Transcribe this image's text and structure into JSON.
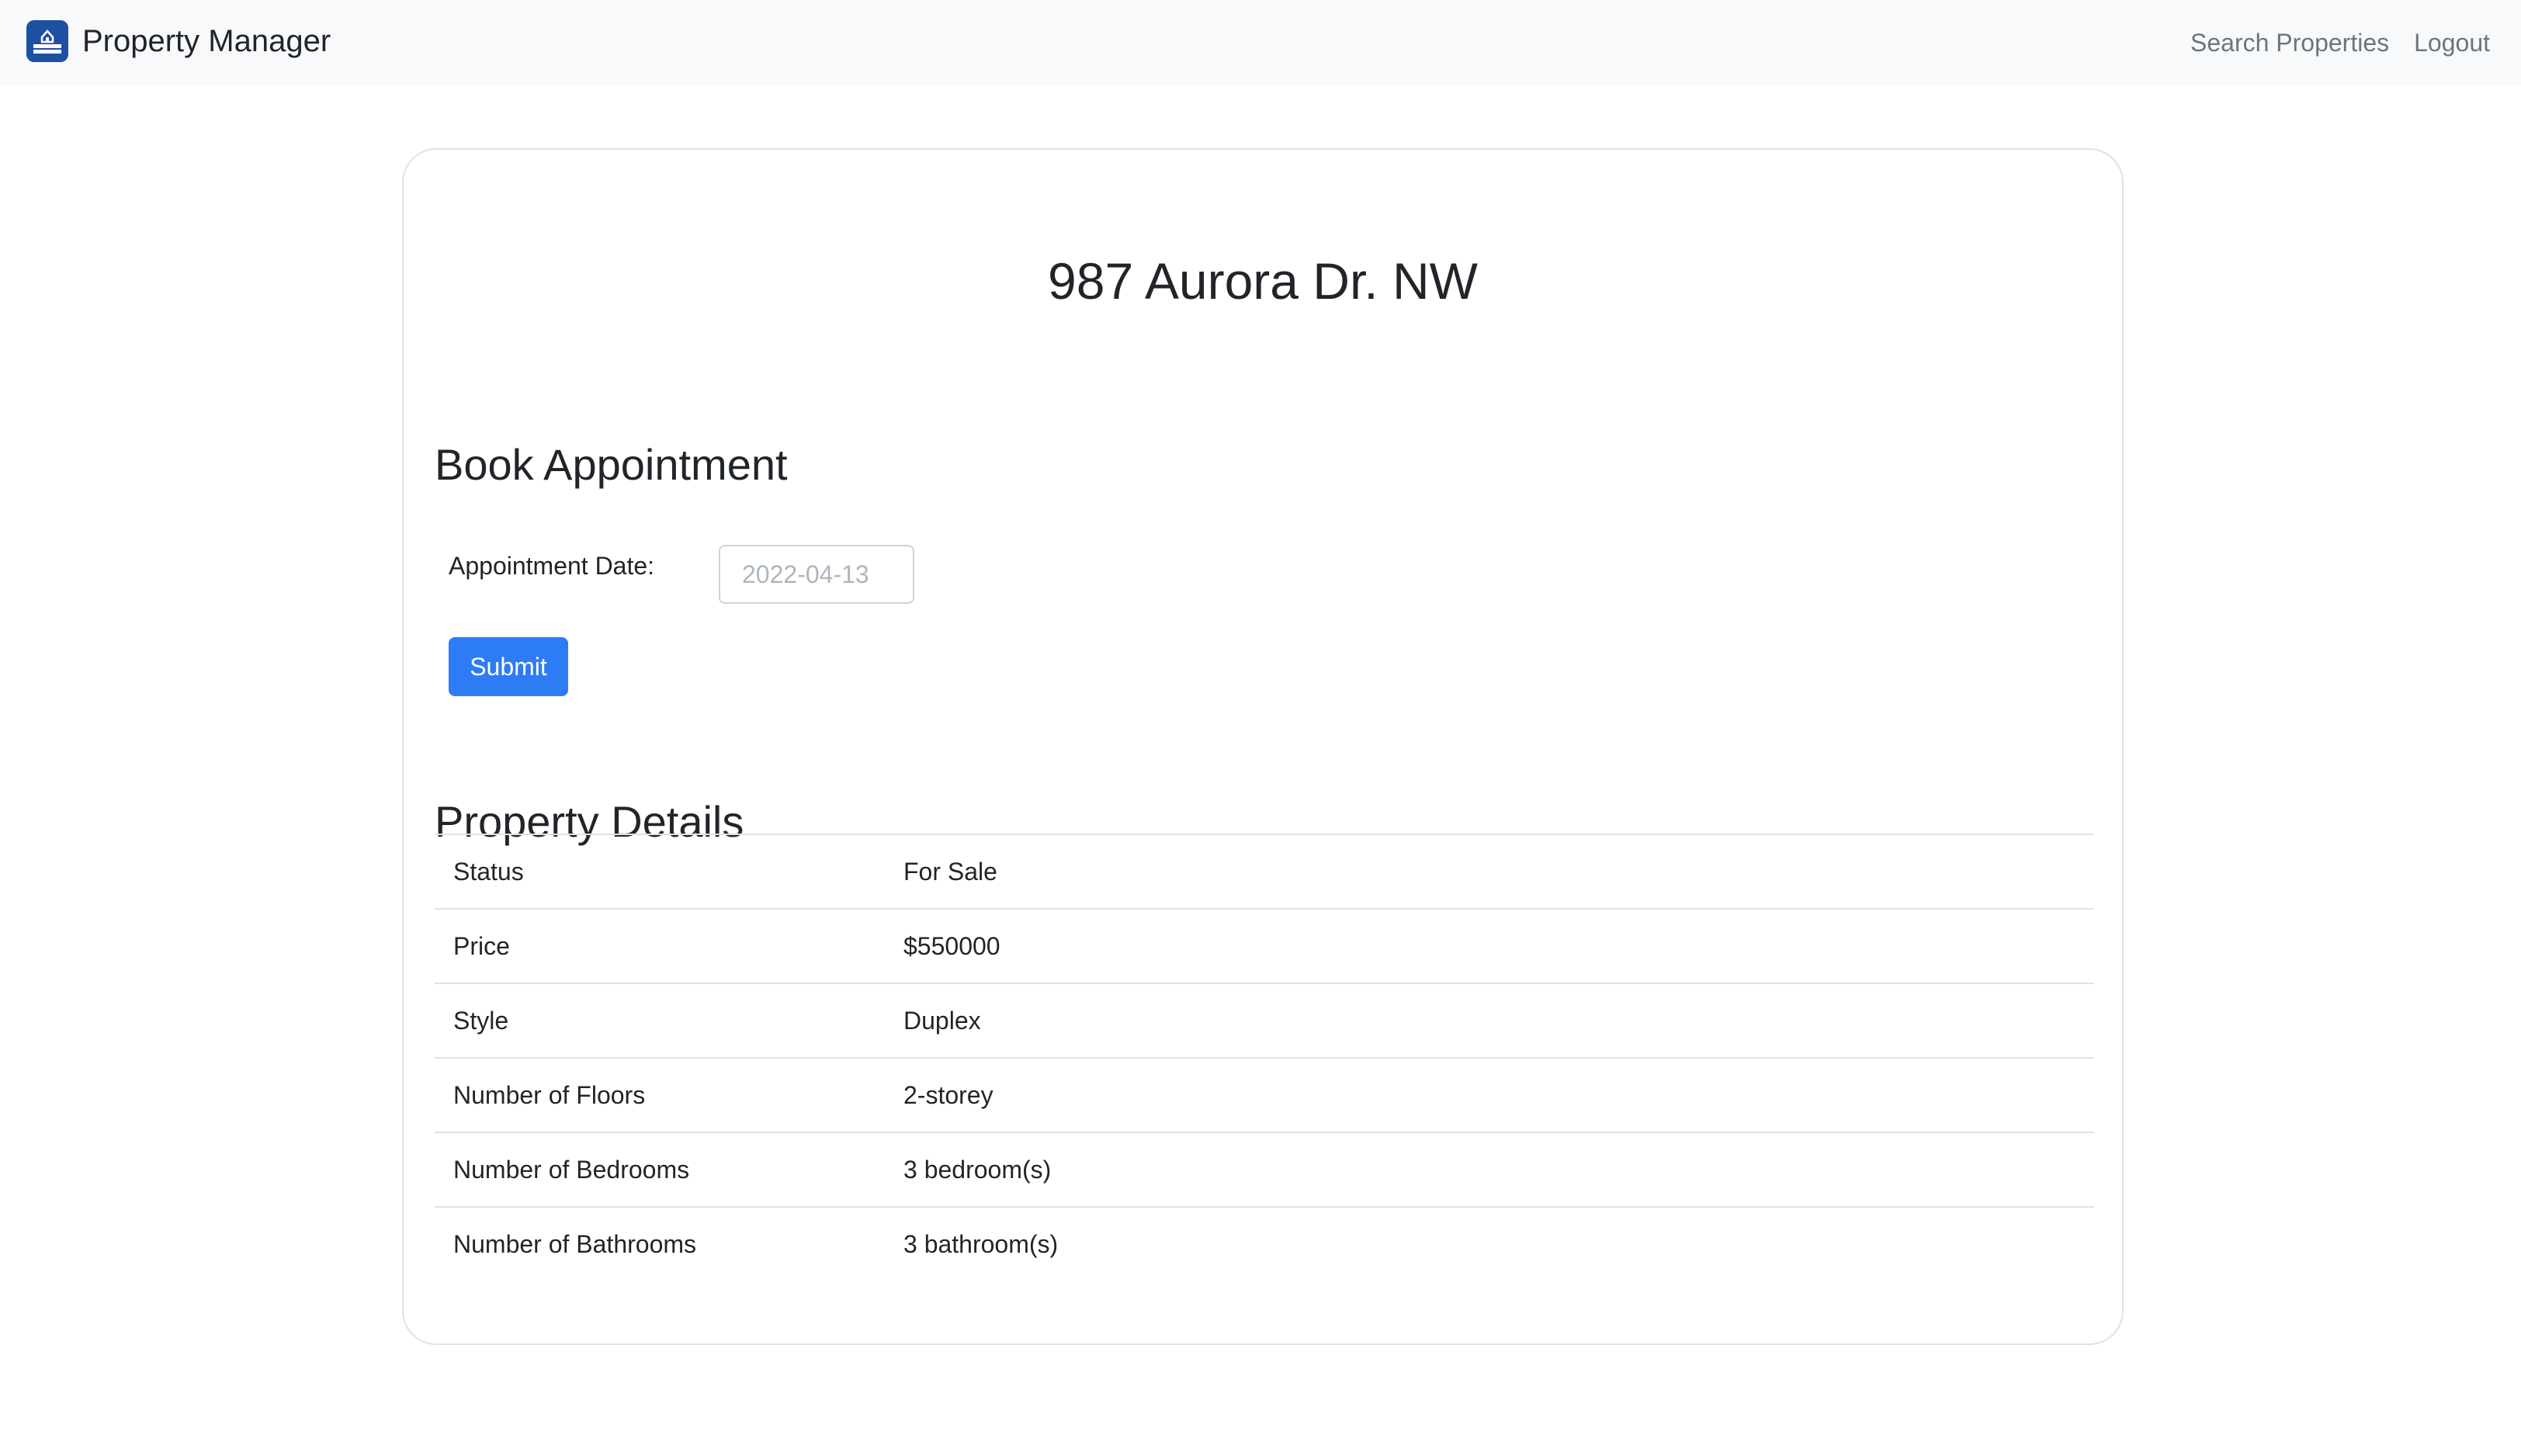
{
  "navbar": {
    "brand_title": "Property Manager",
    "logo_icon": "house-icon",
    "links": {
      "search": "Search Properties",
      "logout": "Logout"
    }
  },
  "property": {
    "address": "987 Aurora Dr. NW"
  },
  "booking": {
    "title": "Book Appointment",
    "date_label": "Appointment Date:",
    "date_value": "2022-04-13",
    "submit_label": "Submit"
  },
  "details": {
    "title": "Property Details",
    "rows": [
      {
        "key": "Status",
        "value": "For Sale"
      },
      {
        "key": "Price",
        "value": "$550000"
      },
      {
        "key": "Style",
        "value": "Duplex"
      },
      {
        "key": "Number of Floors",
        "value": "2-storey"
      },
      {
        "key": "Number of Bedrooms",
        "value": "3 bedroom(s)"
      },
      {
        "key": "Number of Bathrooms",
        "value": "3 bathroom(s)"
      }
    ]
  },
  "colors": {
    "primary": "#2d7cf6",
    "navbar_bg": "#f8f9fa",
    "logo_bg": "#1f4fa3",
    "muted_link": "#6c757d"
  }
}
